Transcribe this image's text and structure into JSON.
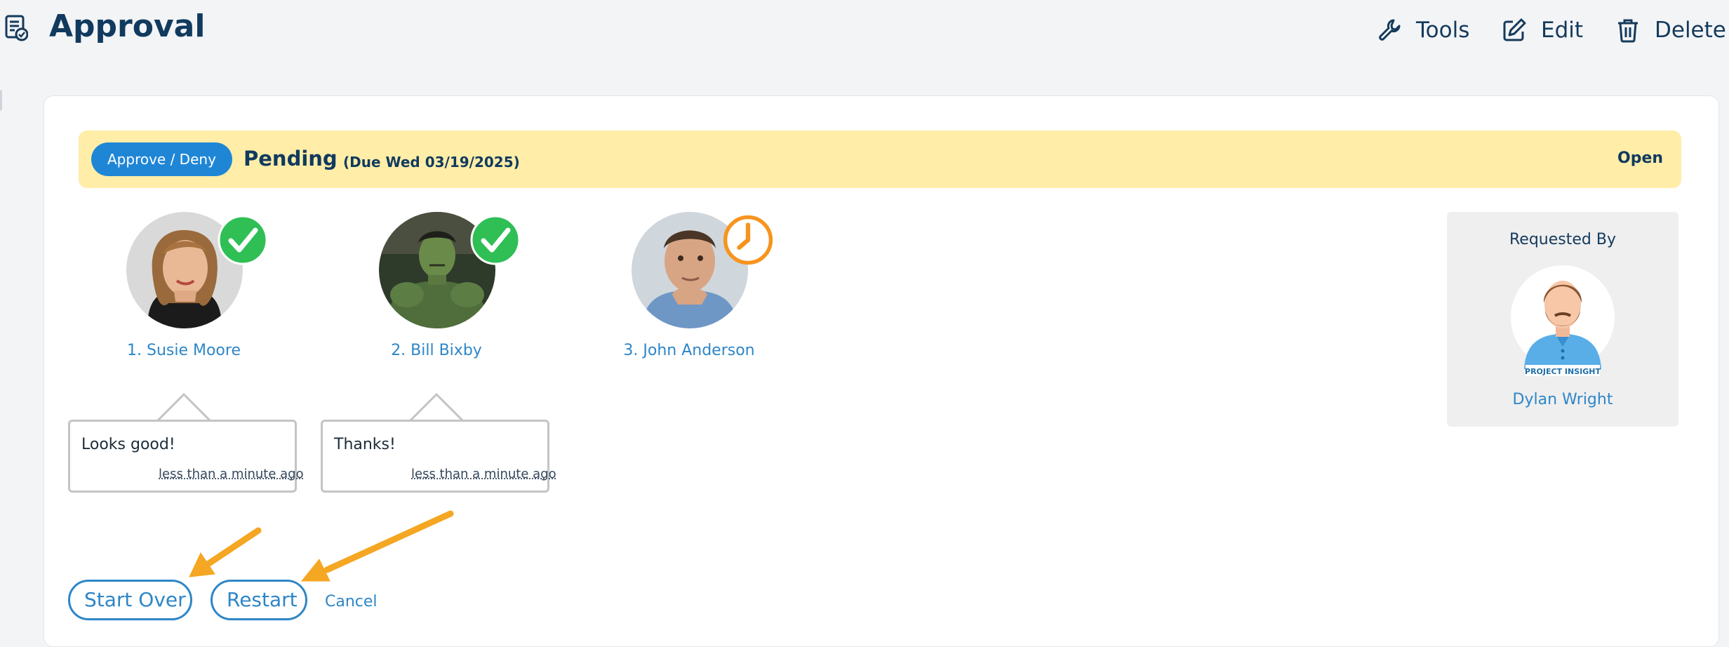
{
  "header": {
    "title": "Approval",
    "page_icon": "approval-doc-icon",
    "actions": [
      {
        "label": "Tools",
        "icon": "wrench-icon"
      },
      {
        "label": "Edit",
        "icon": "edit-icon"
      },
      {
        "label": "Delete",
        "icon": "trash-icon"
      }
    ]
  },
  "status_bar": {
    "button_label": "Approve / Deny",
    "status": "Pending",
    "due": "(Due Wed 03/19/2025)",
    "state": "Open"
  },
  "approvers": [
    {
      "name": "1. Susie Moore",
      "status": "approved",
      "status_icon": "check-circle-icon",
      "comment": "Looks good!",
      "time": "less than a minute ago"
    },
    {
      "name": "2. Bill Bixby",
      "status": "approved",
      "status_icon": "check-circle-icon",
      "comment": "Thanks!",
      "time": "less than a minute ago"
    },
    {
      "name": "3. John Anderson",
      "status": "pending",
      "status_icon": "clock-icon"
    }
  ],
  "requested_by": {
    "label": "Requested By",
    "name": "Dylan Wright",
    "logo_text": "PROJECT INSIGHT"
  },
  "actions": {
    "start_over": "Start Over",
    "restart": "Restart",
    "cancel": "Cancel"
  },
  "colors": {
    "accent": "#2e86c7",
    "button_blue": "#1f86d6",
    "status_bar": "#ffeda8",
    "approved": "#2fbf55",
    "pending": "#f7941d",
    "annotation_arrow": "#f5a623"
  }
}
